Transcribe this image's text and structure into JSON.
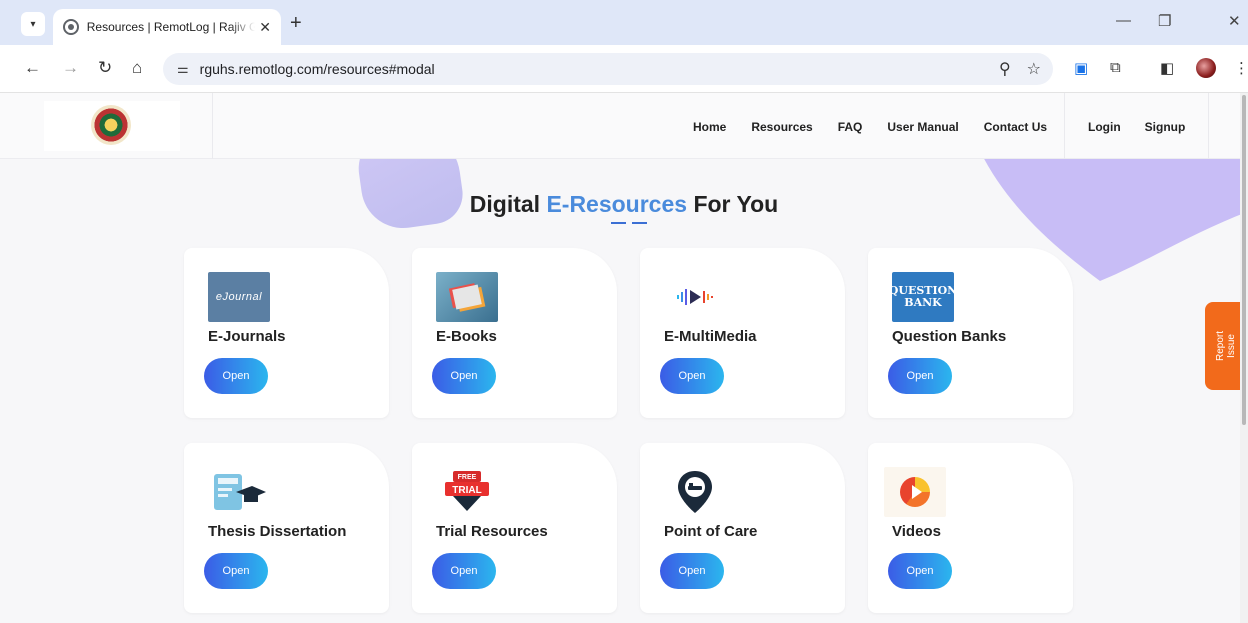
{
  "browser": {
    "tab_title": "Resources | RemotLog | Rajiv Gandhi",
    "tab_close": "✕",
    "new_tab": "+",
    "url": "rguhs.remotlog.com/resources#modal",
    "window_controls": {
      "minimize": "—",
      "restore": "❐",
      "close": "✕"
    }
  },
  "site": {
    "nav": [
      "Home",
      "Resources",
      "FAQ",
      "User Manual",
      "Contact Us"
    ],
    "auth": {
      "login": "Login",
      "signup": "Signup"
    }
  },
  "section": {
    "title_part1": "Digital ",
    "title_accent": "E-Resources",
    "title_part2": " For You"
  },
  "cards": [
    {
      "label": "E-Journals",
      "button": "Open",
      "icon": "ejournal-icon",
      "thumb_text": "eJournal"
    },
    {
      "label": "E-Books",
      "button": "Open",
      "icon": "ebooks-icon"
    },
    {
      "label": "E-MultiMedia",
      "button": "Open",
      "icon": "multimedia-icon"
    },
    {
      "label": "Question Banks",
      "button": "Open",
      "icon": "question-bank-icon",
      "thumb_text": "QUESTION BANK"
    },
    {
      "label": "Thesis Dissertation",
      "button": "Open",
      "icon": "thesis-icon"
    },
    {
      "label": "Trial Resources",
      "button": "Open",
      "icon": "free-trial-icon",
      "badge_top": "FREE",
      "badge_bottom": "TRIAL"
    },
    {
      "label": "Point of Care",
      "button": "Open",
      "icon": "point-of-care-icon"
    },
    {
      "label": "Videos",
      "button": "Open",
      "icon": "videos-icon"
    }
  ],
  "report_issue": {
    "line1": "Report",
    "line2": "Issue"
  },
  "colors": {
    "accent": "#4a8bdc",
    "button_from": "#3b5ce6",
    "button_to": "#2bb6ee",
    "report": "#f26a1b"
  }
}
